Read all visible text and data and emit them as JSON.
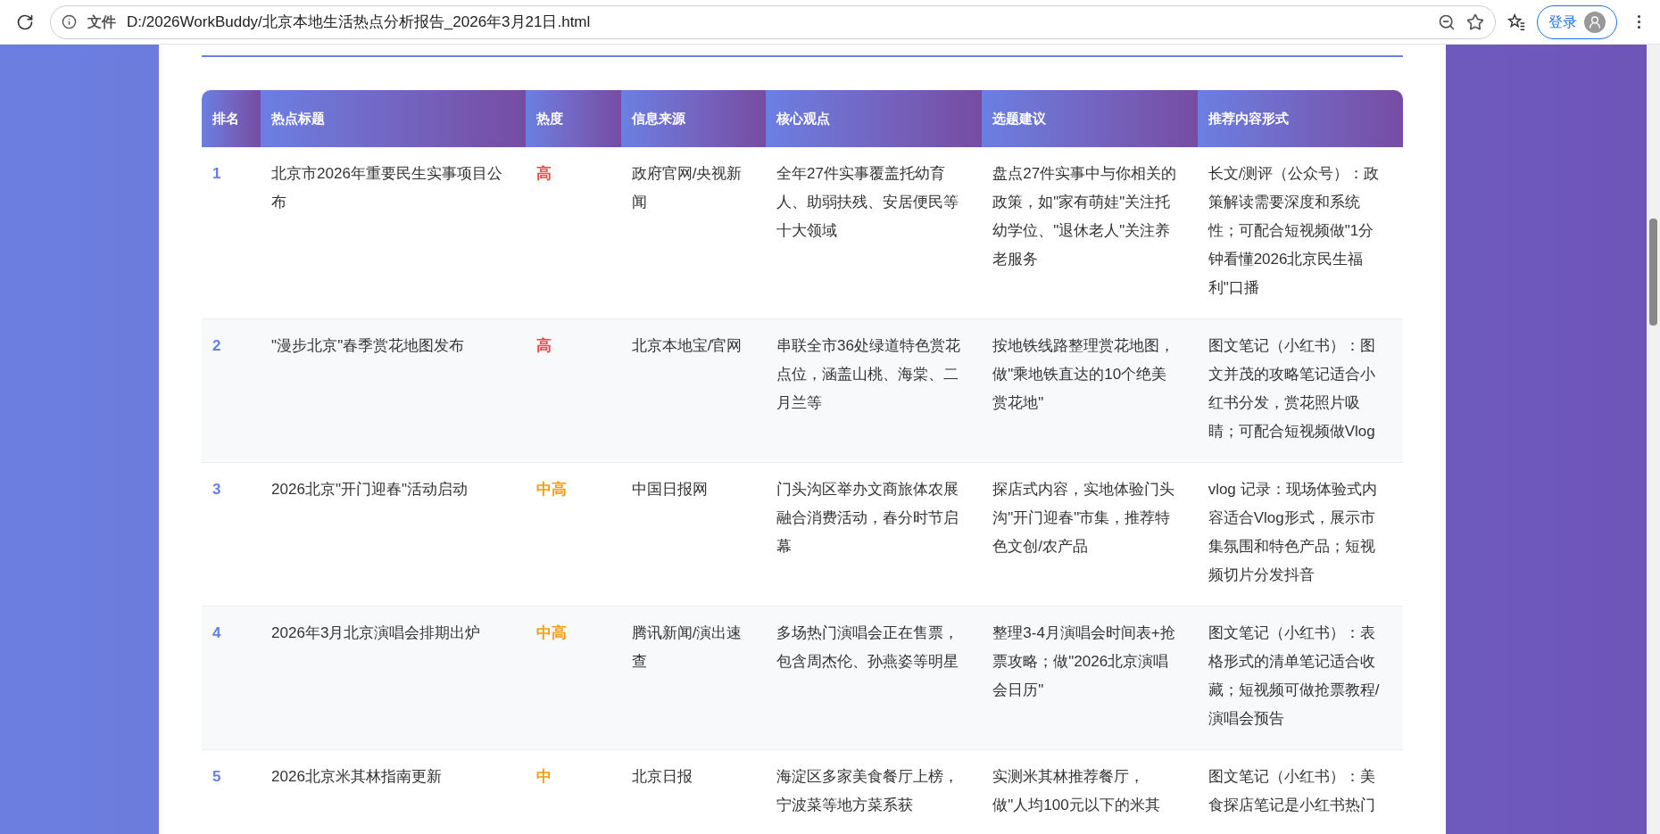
{
  "browser": {
    "scheme": "文件",
    "url": "D:/2026WorkBuddy/北京本地生活热点分析报告_2026年3月21日.html",
    "login": "登录"
  },
  "table": {
    "columns": [
      "排名",
      "热点标题",
      "热度",
      "信息来源",
      "核心观点",
      "选题建议",
      "推荐内容形式"
    ],
    "rows": [
      {
        "rank": "1",
        "title": "北京市2026年重要民生实事项目公布",
        "heat": {
          "text": "高",
          "color": "#e74c3c"
        },
        "source": "政府官网/央视新闻",
        "core": "全年27件实事覆盖托幼育人、助弱扶残、安居便民等十大领域",
        "suggestion": "盘点27件实事中与你相关的政策，如\"家有萌娃\"关注托幼学位、\"退休老人\"关注养老服务",
        "format": "长文/测评（公众号）：政策解读需要深度和系统性；可配合短视频做\"1分钟看懂2026北京民生福利\"口播"
      },
      {
        "rank": "2",
        "title": "\"漫步北京\"春季赏花地图发布",
        "heat": {
          "text": "高",
          "color": "#e74c3c"
        },
        "source": "北京本地宝/官网",
        "core": "串联全市36处绿道特色赏花点位，涵盖山桃、海棠、二月兰等",
        "suggestion": "按地铁线路整理赏花地图，做\"乘地铁直达的10个绝美赏花地\"",
        "format": "图文笔记（小红书）：图文并茂的攻略笔记适合小红书分发，赏花照片吸睛；可配合短视频做Vlog"
      },
      {
        "rank": "3",
        "title": "2026北京\"开门迎春\"活动启动",
        "heat": {
          "text": "中高",
          "color": "#f39c12"
        },
        "source": "中国日报网",
        "core": "门头沟区举办文商旅体农展融合消费活动，春分时节启幕",
        "suggestion": "探店式内容，实地体验门头沟\"开门迎春\"市集，推荐特色文创/农产品",
        "format": "vlog 记录：现场体验式内容适合Vlog形式，展示市集氛围和特色产品；短视频切片分发抖音"
      },
      {
        "rank": "4",
        "title": "2026年3月北京演唱会排期出炉",
        "heat": {
          "text": "中高",
          "color": "#f39c12"
        },
        "source": "腾讯新闻/演出速查",
        "core": "多场热门演唱会正在售票，包含周杰伦、孙燕姿等明星",
        "suggestion": "整理3-4月演唱会时间表+抢票攻略；做\"2026北京演唱会日历\"",
        "format": "图文笔记（小红书）：表格形式的清单笔记适合收藏；短视频可做抢票教程/演唱会预告"
      },
      {
        "rank": "5",
        "title": "2026北京米其林指南更新",
        "heat": {
          "text": "中",
          "color": "#f39c12"
        },
        "source": "北京日报",
        "core": "海淀区多家美食餐厅上榜，宁波菜等地方菜系获",
        "suggestion": "实测米其林推荐餐厅，做\"人均100元以下的米其",
        "format": "图文笔记（小红书）：美食探店笔记是小红书热门"
      }
    ]
  }
}
